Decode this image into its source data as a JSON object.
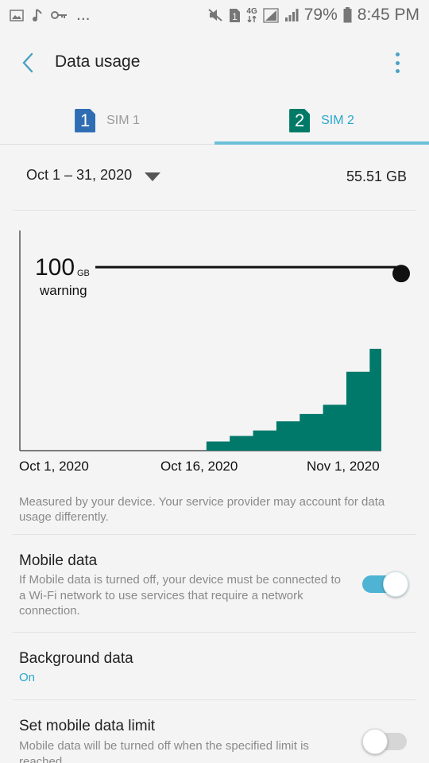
{
  "status_bar": {
    "left_icons": [
      "image-icon",
      "music-note-icon",
      "key-icon"
    ],
    "more_dots": "...",
    "right_icons": [
      "mute-icon",
      "sim1-icon",
      "4g-icon",
      "signal-icon",
      "signal-icon"
    ],
    "network_type": "4G",
    "battery_percent": "79%",
    "time": "8:45 PM"
  },
  "app_bar": {
    "title": "Data usage",
    "back_icon": "back-arrow-icon",
    "more_icon": "more-vertical-icon"
  },
  "tabs": [
    {
      "badge": "1",
      "label": "SIM 1",
      "selected": false
    },
    {
      "badge": "2",
      "label": "SIM 2",
      "selected": true
    }
  ],
  "period": {
    "range": "Oct 1 – 31, 2020",
    "total": "55.51 GB"
  },
  "chart": {
    "warning_value": "100",
    "warning_unit": "GB",
    "warning_label": "warning",
    "x_labels": [
      "Oct 1, 2020",
      "Oct 16, 2020",
      "Nov 1, 2020"
    ]
  },
  "chart_data": {
    "type": "area",
    "xlabel": "",
    "ylabel": "",
    "x_ticks": [
      "Oct 1, 2020",
      "Oct 16, 2020",
      "Nov 1, 2020"
    ],
    "x": [
      15,
      17,
      19,
      21,
      23,
      25,
      27,
      29,
      31
    ],
    "y": [
      0,
      5,
      8,
      11,
      16,
      20,
      25,
      43,
      55.51
    ],
    "ylim": [
      0,
      120
    ],
    "warning_threshold": 100,
    "series_color": "#00796b"
  },
  "note": "Measured by your device. Your service provider may account for data usage differently.",
  "settings": {
    "mobile_data": {
      "title": "Mobile data",
      "description": "If Mobile data is turned off, your device must be connected to a Wi-Fi network to use services that require a network connection.",
      "enabled": true
    },
    "background_data": {
      "title": "Background data",
      "value": "On"
    },
    "data_limit": {
      "title": "Set mobile data limit",
      "description": "Mobile data will be turned off when the specified limit is reached.",
      "enabled": false
    }
  },
  "colors": {
    "accent": "#2aa7cc",
    "sim1": "#2f6db3",
    "sim2": "#007a67",
    "chart_fill": "#00796b"
  }
}
